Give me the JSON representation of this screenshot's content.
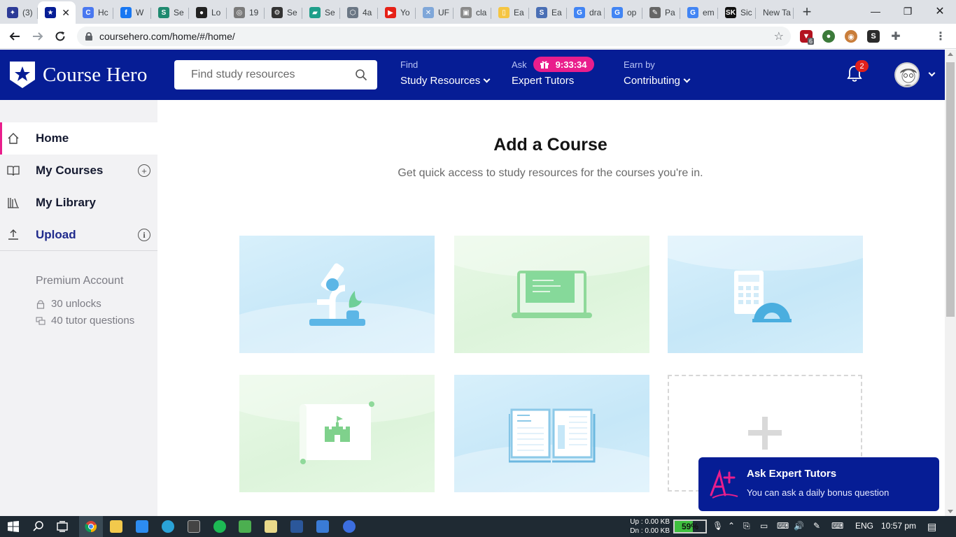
{
  "browser": {
    "tabs": [
      {
        "title": "(3)",
        "fav_color": "#2d3b97",
        "fav_glyph": "✦"
      },
      {
        "title": "",
        "fav_color": "#061d95",
        "fav_glyph": "★",
        "active": true
      },
      {
        "title": "Hc",
        "fav_color": "#4a78f0",
        "fav_glyph": "C"
      },
      {
        "title": "W",
        "fav_color": "#1877f2",
        "fav_glyph": "f"
      },
      {
        "title": "Se",
        "fav_color": "#1f8a70",
        "fav_glyph": "S"
      },
      {
        "title": "Lo",
        "fav_color": "#222222",
        "fav_glyph": "●"
      },
      {
        "title": "19",
        "fav_color": "#7a7a7a",
        "fav_glyph": "◎"
      },
      {
        "title": "Se",
        "fav_color": "#333333",
        "fav_glyph": "⚙"
      },
      {
        "title": "Se",
        "fav_color": "#1e9e8a",
        "fav_glyph": "▰"
      },
      {
        "title": "4a",
        "fav_color": "#6b7785",
        "fav_glyph": "⬡"
      },
      {
        "title": "Yo",
        "fav_color": "#e62117",
        "fav_glyph": "▶"
      },
      {
        "title": "UF",
        "fav_color": "#7fa7d9",
        "fav_glyph": "✕"
      },
      {
        "title": "cla",
        "fav_color": "#8a8a8a",
        "fav_glyph": "▣"
      },
      {
        "title": "Ea",
        "fav_color": "#f5c542",
        "fav_glyph": "▯"
      },
      {
        "title": "Ea",
        "fav_color": "#4a6fb5",
        "fav_glyph": "S"
      },
      {
        "title": "dra",
        "fav_color": "#4285f4",
        "fav_glyph": "G"
      },
      {
        "title": "op",
        "fav_color": "#4285f4",
        "fav_glyph": "G"
      },
      {
        "title": "Pa",
        "fav_color": "#666666",
        "fav_glyph": "✎"
      },
      {
        "title": "em",
        "fav_color": "#4285f4",
        "fav_glyph": "G"
      },
      {
        "title": "Sic",
        "fav_color": "#111111",
        "fav_glyph": "SK"
      },
      {
        "title": "New Ta",
        "fav_color": "",
        "fav_glyph": ""
      }
    ],
    "new_tab_label": "+",
    "url": "coursehero.com/home/#/home/",
    "window_controls": {
      "minimize": "—",
      "restore": "❐",
      "close": "✕"
    },
    "extension_badge": "6"
  },
  "header": {
    "logo_text": "Course Hero",
    "search_placeholder": "Find study resources",
    "nav": {
      "find_label": "Find",
      "find_link": "Study Resources",
      "ask_label": "Ask",
      "ask_timer": "9:33:34",
      "ask_link": "Expert Tutors",
      "earn_label": "Earn by",
      "earn_link": "Contributing"
    },
    "notification_count": "2",
    "colors": {
      "brand": "#061d95",
      "accent": "#e91e8c",
      "badge": "#e0201b"
    }
  },
  "sidebar": {
    "items": [
      {
        "label": "Home",
        "icon": "home-icon",
        "active": true
      },
      {
        "label": "My Courses",
        "icon": "book-icon",
        "trailing": "add-circle-icon"
      },
      {
        "label": "My Library",
        "icon": "library-icon"
      },
      {
        "label": "Upload",
        "icon": "upload-icon",
        "trailing": "info-icon"
      }
    ],
    "premium": {
      "title": "Premium Account",
      "unlocks": "30 unlocks",
      "tutor_questions": "40 tutor questions"
    }
  },
  "main": {
    "title": "Add a Course",
    "subtitle": "Get quick access to study resources for the courses you're in.",
    "cards": [
      {
        "subject_icon": "microscope-icon",
        "theme": "blue"
      },
      {
        "subject_icon": "laptop-code-icon",
        "theme": "green"
      },
      {
        "subject_icon": "calculator-protractor-icon",
        "theme": "blue"
      },
      {
        "subject_icon": "map-castle-icon",
        "theme": "green"
      },
      {
        "subject_icon": "open-book-icon",
        "theme": "blue"
      },
      {
        "subject_icon": "add-course-plus-icon",
        "theme": "dashed"
      }
    ]
  },
  "toast": {
    "title": "Ask Expert Tutors",
    "body": "You can ask a daily bonus question"
  },
  "taskbar": {
    "net_up": "Up : 0.00 KB",
    "net_down": "Dn : 0.00 KB",
    "battery_percent": 59,
    "battery_label": "59%",
    "language": "ENG",
    "time": "10:57 pm"
  }
}
